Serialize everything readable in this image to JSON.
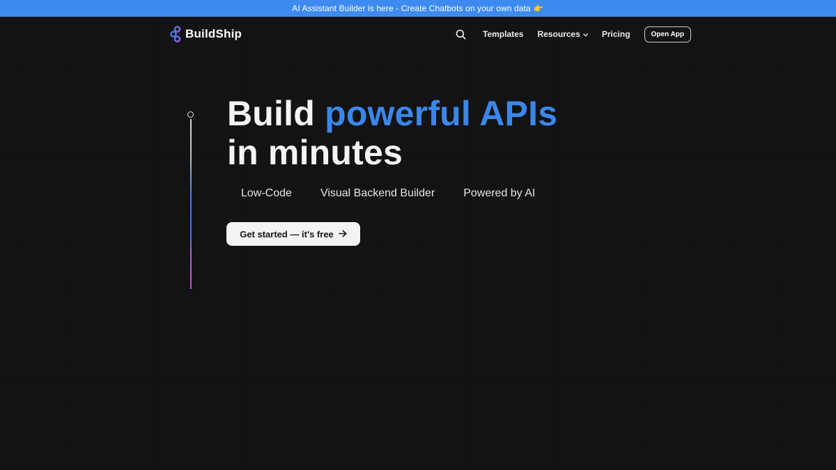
{
  "announcement": {
    "text": "AI Assistant Builder is here - Create Chatbots on your own data",
    "emoji": "👉"
  },
  "nav": {
    "logo_text": "BuildShip",
    "search_icon": "search-icon",
    "items": [
      {
        "label": "Templates"
      },
      {
        "label": "Resources",
        "icon": "chevron-down-icon"
      },
      {
        "label": "Pricing"
      }
    ],
    "open_app_label": "Open App"
  },
  "hero": {
    "title_line1_plain": "Build",
    "title_line1_accent": "powerful APIs",
    "title_line2": "in minutes",
    "features": [
      "Low-Code",
      "Visual Backend Builder",
      "Powered by AI"
    ],
    "cta_label": "Get started — it's free",
    "cta_icon": "arrow-right-icon"
  },
  "colors": {
    "background": "#131315",
    "announcement_bar": "#3d8bf1",
    "accent": "#3b87e8",
    "cta_background": "#f3f3f3",
    "timeline_gradient": [
      "#d9d9d9",
      "#3c7fe6",
      "#c04fd0"
    ]
  }
}
